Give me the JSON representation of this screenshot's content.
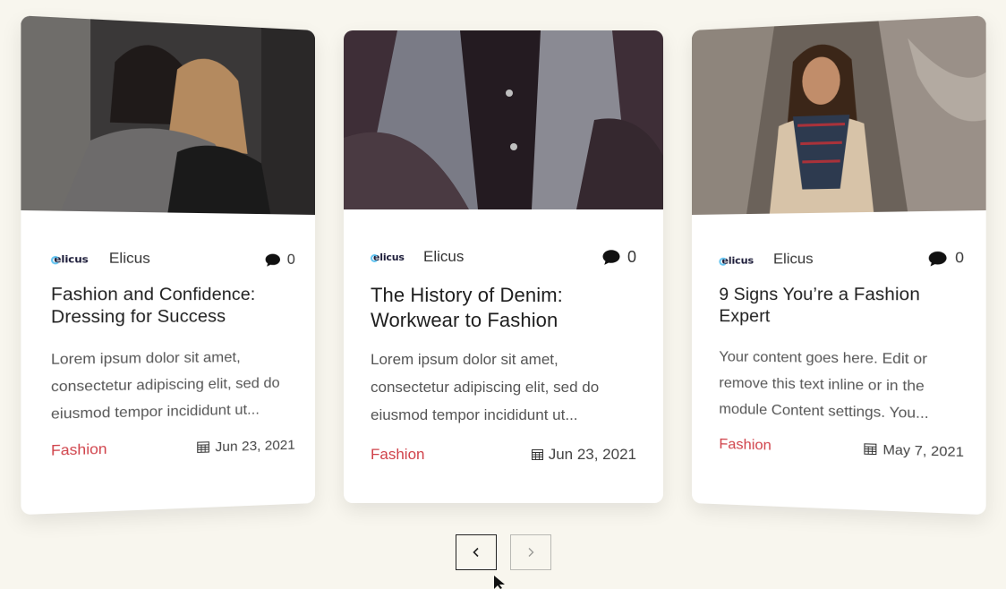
{
  "cards": [
    {
      "author": "Elicus",
      "logo_text": "elicus",
      "comments": "0",
      "title": "Fashion and Confidence: Dressing for Success",
      "excerpt": "Lorem ipsum dolor sit amet, consectetur adipiscing elit, sed do eiusmod tempor incididunt ut...",
      "category": "Fashion",
      "date": "Jun 23, 2021"
    },
    {
      "author": "Elicus",
      "logo_text": "elicus",
      "comments": "0",
      "title": "The History of Denim: Workwear to Fashion",
      "excerpt": "Lorem ipsum dolor sit amet, consectetur adipiscing elit, sed do eiusmod tempor incididunt ut...",
      "category": "Fashion",
      "date": "Jun 23, 2021"
    },
    {
      "author": "Elicus",
      "logo_text": "elicus",
      "comments": "0",
      "title": "9 Signs You’re a Fashion Expert",
      "excerpt": "Your content goes here. Edit or remove this text inline or in the module Content settings. You...",
      "category": "Fashion",
      "date": "May 7, 2021"
    }
  ],
  "nav": {
    "prev_icon": "chevron-left-icon",
    "next_icon": "chevron-right-icon"
  },
  "colors": {
    "background": "#f8f6ee",
    "category": "#d0424a",
    "card": "#ffffff"
  }
}
